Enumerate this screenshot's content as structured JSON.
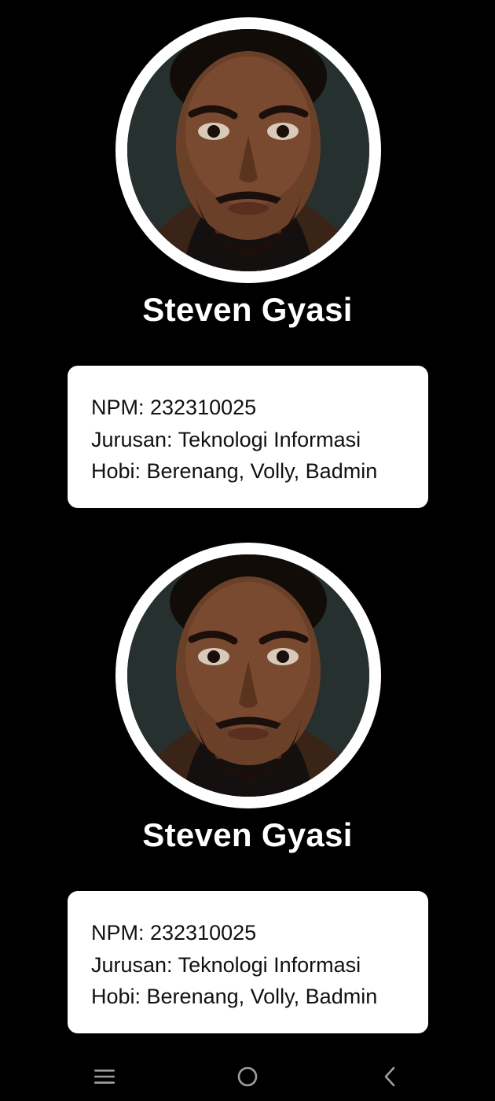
{
  "profiles": [
    {
      "name": "Steven Gyasi",
      "photo": "avatar-portrait",
      "info": {
        "npm": "NPM: 232310025",
        "jurusan": "Jurusan: Teknologi Informasi",
        "hobi": "Hobi: Berenang, Volly, Badmin"
      }
    },
    {
      "name": "Steven Gyasi",
      "photo": "avatar-portrait",
      "info": {
        "npm": "NPM: 232310025",
        "jurusan": "Jurusan: Teknologi Informasi",
        "hobi": "Hobi: Berenang, Volly, Badmin"
      }
    }
  ],
  "navbar": {
    "icons": [
      "menu-icon",
      "home-icon",
      "back-icon"
    ]
  },
  "colors": {
    "background": "#000000",
    "card": "#ffffff",
    "text_on_dark": "#ffffff",
    "text_on_card": "#111111",
    "nav_icon": "#9e9e9e"
  }
}
